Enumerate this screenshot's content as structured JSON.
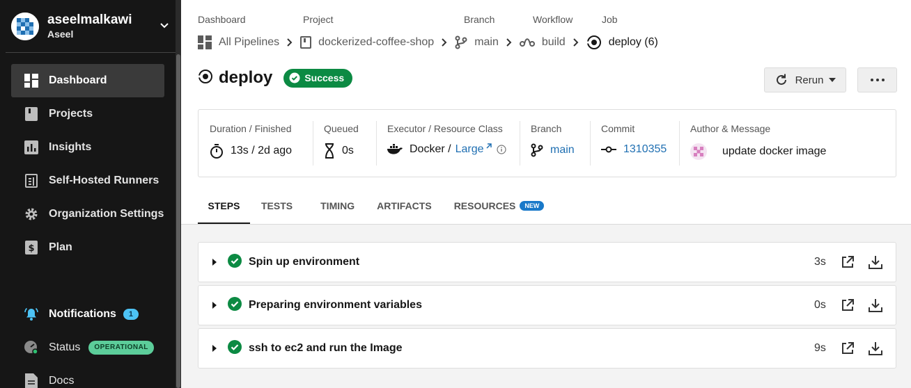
{
  "org": {
    "name": "aseelmalkawi",
    "user": "Aseel"
  },
  "sidebar": {
    "items": [
      {
        "label": "Dashboard",
        "icon": "dashboard-icon"
      },
      {
        "label": "Projects",
        "icon": "book-icon"
      },
      {
        "label": "Insights",
        "icon": "chart-icon"
      },
      {
        "label": "Self-Hosted Runners",
        "icon": "runner-icon"
      },
      {
        "label": "Organization Settings",
        "icon": "gear-icon"
      },
      {
        "label": "Plan",
        "icon": "dollar-icon"
      }
    ],
    "notifications": {
      "label": "Notifications",
      "count": "1"
    },
    "status": {
      "label": "Status",
      "badge": "OPERATIONAL"
    },
    "docs": {
      "label": "Docs"
    }
  },
  "breadcrumb": {
    "labels": [
      "Dashboard",
      "Project",
      "Branch",
      "Workflow",
      "Job"
    ],
    "items": [
      "All Pipelines",
      "dockerized-coffee-shop",
      "main",
      "build",
      "deploy (6)"
    ]
  },
  "job": {
    "title": "deploy",
    "status": "Success"
  },
  "actions": {
    "rerun": "Rerun"
  },
  "info": {
    "duration_label": "Duration / Finished",
    "duration_value": "13s / 2d ago",
    "queued_label": "Queued",
    "queued_value": "0s",
    "executor_label": "Executor / Resource Class",
    "executor_value": "Docker /",
    "resource_class": "Large",
    "branch_label": "Branch",
    "branch_value": "main",
    "commit_label": "Commit",
    "commit_value": "1310355",
    "author_label": "Author & Message",
    "message": "update docker image"
  },
  "tabs": [
    {
      "label": "STEPS"
    },
    {
      "label": "TESTS"
    },
    {
      "label": "TIMING"
    },
    {
      "label": "ARTIFACTS"
    },
    {
      "label": "RESOURCES",
      "badge": "NEW"
    }
  ],
  "steps": [
    {
      "name": "Spin up environment",
      "duration": "3s"
    },
    {
      "name": "Preparing environment variables",
      "duration": "0s"
    },
    {
      "name": "ssh to ec2 and run the Image",
      "duration": "9s"
    }
  ],
  "colors": {
    "success": "#0c8a43",
    "link": "#1f6fb2",
    "sidebar": "#161616",
    "notification": "#4dc3f5",
    "operational": "#5ccd9a"
  }
}
